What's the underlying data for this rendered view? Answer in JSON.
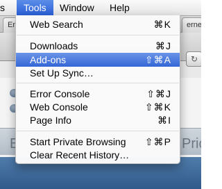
{
  "menubar": {
    "items": [
      {
        "label": "s"
      },
      {
        "label": "Tools"
      },
      {
        "label": "Window"
      },
      {
        "label": "Help"
      }
    ]
  },
  "background": {
    "tab_left": "Em",
    "tab_right": "ernet Connect",
    "band_left": "E",
    "band_right": "Prici"
  },
  "menu": {
    "items": [
      {
        "label": "Web Search",
        "shortcut": "⌘K"
      },
      {
        "label": "Downloads",
        "shortcut": "⌘J"
      },
      {
        "label": "Add-ons",
        "shortcut": "⇧⌘A"
      },
      {
        "label": "Set Up Sync…",
        "shortcut": ""
      },
      {
        "label": "Error Console",
        "shortcut": "⇧⌘J"
      },
      {
        "label": "Web Console",
        "shortcut": "⇧⌘K"
      },
      {
        "label": "Page Info",
        "shortcut": "⌘I"
      },
      {
        "label": "Start Private Browsing",
        "shortcut": "⇧⌘P"
      },
      {
        "label": "Clear Recent History…",
        "shortcut": ""
      }
    ],
    "highlighted_index": 2
  },
  "colors": {
    "highlight": "#3366d6",
    "menubar_active": "#2a5fd6"
  }
}
